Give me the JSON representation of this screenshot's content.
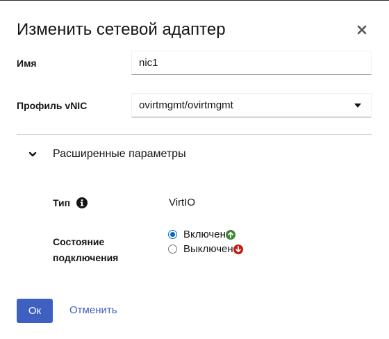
{
  "dialog": {
    "title": "Изменить сетевой адаптер"
  },
  "fields": {
    "name": {
      "label": "Имя",
      "value": "nic1"
    },
    "vnic_profile": {
      "label": "Профиль vNIC",
      "value": "ovirtmgmt/ovirtmgmt"
    }
  },
  "advanced": {
    "label": "Расширенные параметры",
    "type": {
      "label": "Тип",
      "value": "VirtIO"
    },
    "link_state": {
      "label": "Состояние подключения",
      "options": [
        {
          "label": "Включен",
          "checked": true
        },
        {
          "label": "Выключен",
          "checked": false
        }
      ]
    }
  },
  "footer": {
    "ok_label": "Ок",
    "cancel_label": "Отменить"
  },
  "colors": {
    "primary": "#3e60c1",
    "up_green": "#3e8635",
    "down_red": "#c9190b"
  },
  "icons": [
    "close-icon",
    "chevron-down-icon",
    "info-icon",
    "arrow-up-circle-icon",
    "arrow-down-circle-icon"
  ]
}
